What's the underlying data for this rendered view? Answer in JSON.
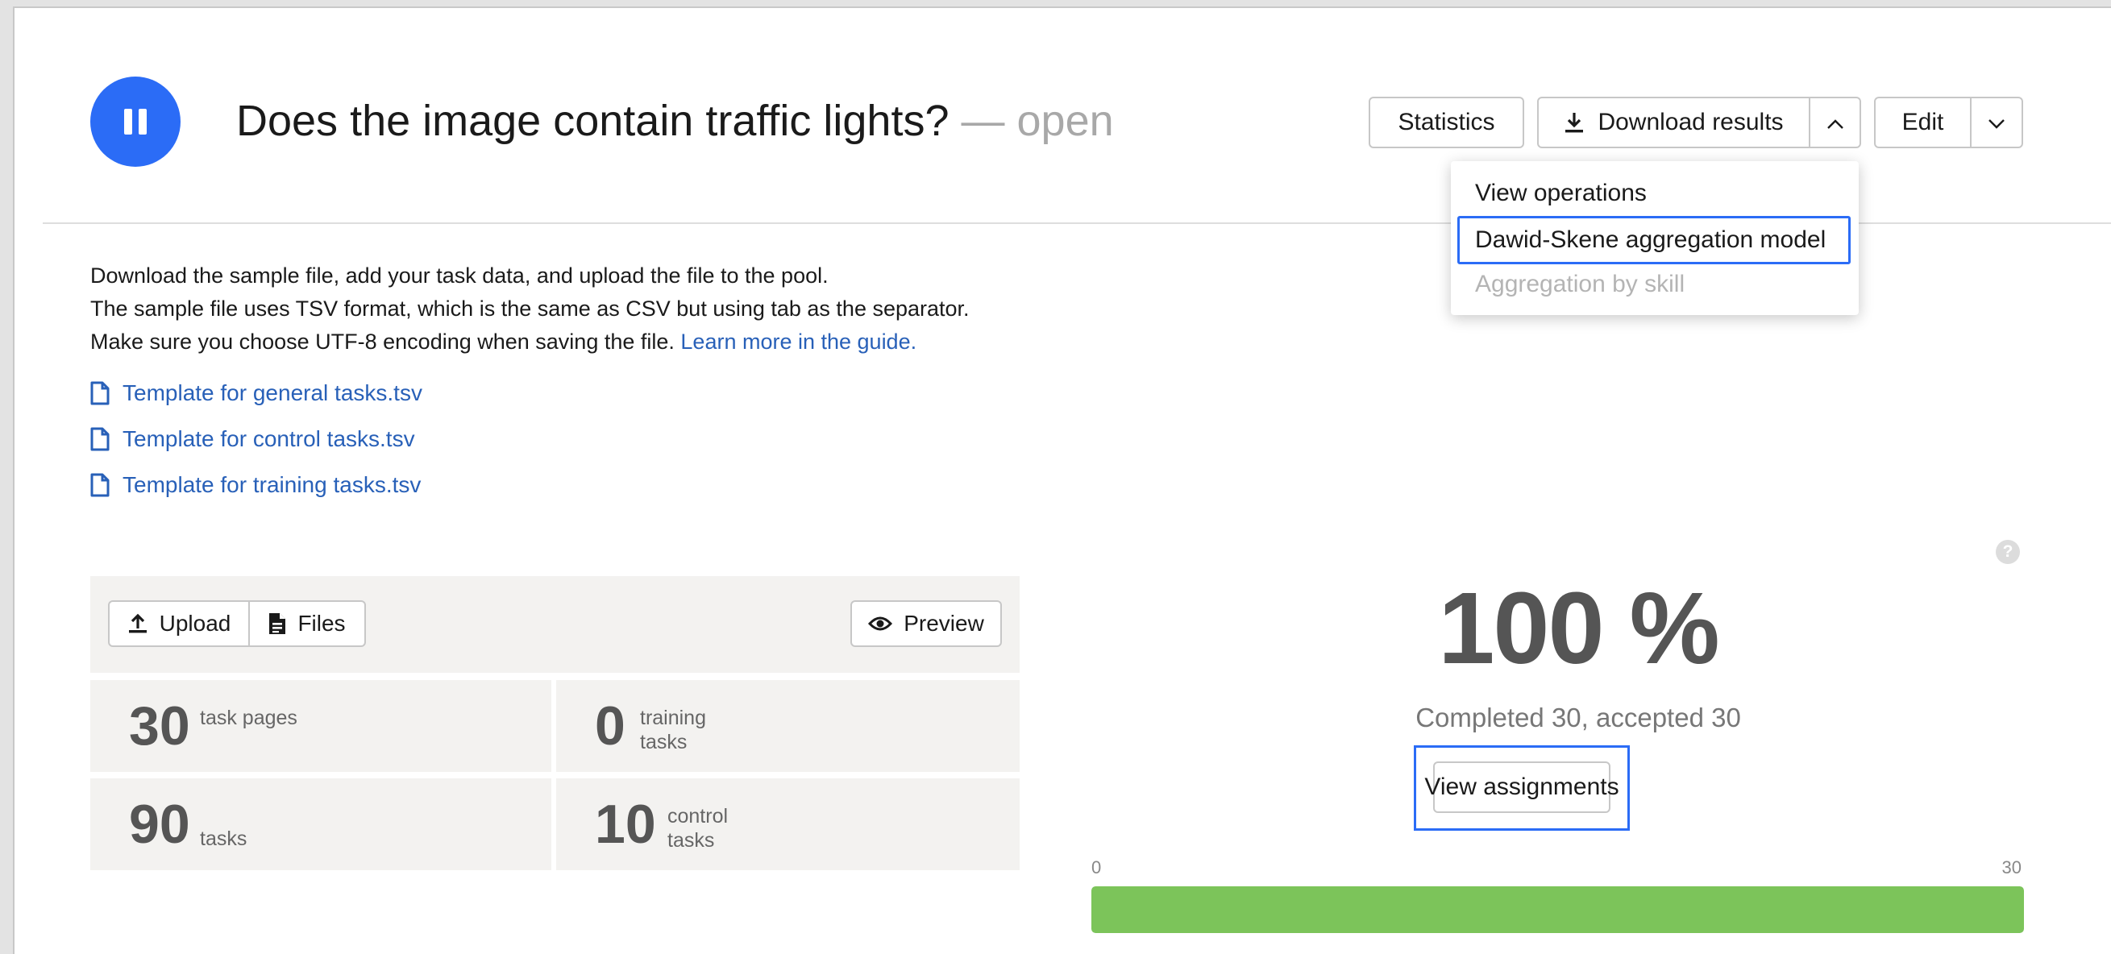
{
  "header": {
    "title": "Does the image contain traffic lights?",
    "status": "— open",
    "buttons": {
      "statistics": "Statistics",
      "download_results": "Download results",
      "edit": "Edit"
    }
  },
  "download_menu": {
    "items": [
      {
        "label": "View operations",
        "enabled": true
      },
      {
        "label": "Dawid-Skene aggregation model",
        "enabled": true,
        "focused": true
      },
      {
        "label": "Aggregation by skill",
        "enabled": false
      }
    ]
  },
  "instructions": {
    "line1": "Download the sample file, add your task data, and upload the file to the pool.",
    "line2": "The sample file uses TSV format, which is the same as CSV but using tab as the separator.",
    "line3": "Make sure you choose UTF-8 encoding when saving the file.",
    "link": "Learn more in the guide."
  },
  "templates": [
    "Template for general tasks.tsv",
    "Template for control tasks.tsv",
    "Template for training tasks.tsv"
  ],
  "panel": {
    "upload": "Upload",
    "files": "Files",
    "preview": "Preview"
  },
  "stats": [
    {
      "value": "30",
      "label": "task pages"
    },
    {
      "value": "0",
      "label": "training tasks"
    },
    {
      "value": "90",
      "label": "tasks"
    },
    {
      "value": "10",
      "label": "control tasks"
    }
  ],
  "progress": {
    "percent_text": "100 %",
    "summary": "Completed 30, accepted 30",
    "view_assignments": "View assignments",
    "axis_min": "0",
    "axis_max": "30",
    "completed": 30,
    "total": 30,
    "bar_color": "#7cc45a"
  },
  "colors": {
    "accent": "#2b6cf6",
    "link": "#2860b8"
  },
  "icons": {
    "pause": "pause-icon",
    "download": "download-icon",
    "chevron_up": "chevron-up-icon",
    "chevron_down": "chevron-down-icon",
    "file": "file-icon",
    "upload": "upload-icon",
    "document": "document-icon",
    "eye": "eye-icon",
    "help": "help-icon"
  }
}
